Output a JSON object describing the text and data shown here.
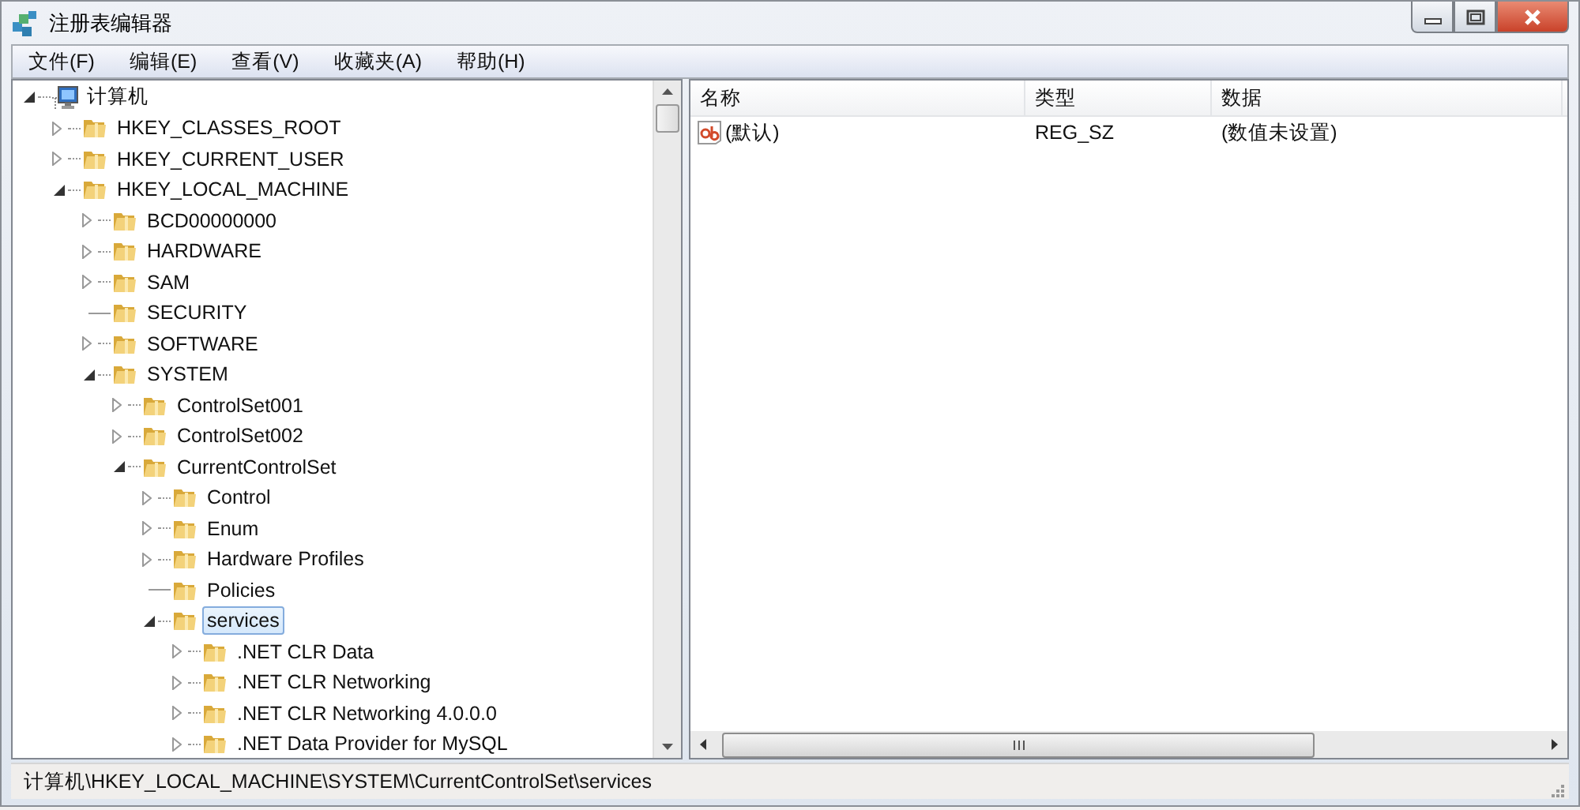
{
  "window": {
    "title": "注册表编辑器"
  },
  "menu": [
    "文件(F)",
    "编辑(E)",
    "查看(V)",
    "收藏夹(A)",
    "帮助(H)"
  ],
  "tree": [
    {
      "label": "计算机",
      "kind": "computer",
      "expanded": true,
      "selected": false,
      "children": [
        {
          "label": "HKEY_CLASSES_ROOT",
          "kind": "key",
          "expanded": false,
          "selected": false
        },
        {
          "label": "HKEY_CURRENT_USER",
          "kind": "key",
          "expanded": false,
          "selected": false
        },
        {
          "label": "HKEY_LOCAL_MACHINE",
          "kind": "key",
          "expanded": true,
          "selected": false,
          "children": [
            {
              "label": "BCD00000000",
              "kind": "key",
              "expanded": false,
              "selected": false
            },
            {
              "label": "HARDWARE",
              "kind": "key",
              "expanded": false,
              "selected": false
            },
            {
              "label": "SAM",
              "kind": "key",
              "expanded": false,
              "selected": false
            },
            {
              "label": "SECURITY",
              "kind": "leaf",
              "selected": false
            },
            {
              "label": "SOFTWARE",
              "kind": "key",
              "expanded": false,
              "selected": false
            },
            {
              "label": "SYSTEM",
              "kind": "key",
              "expanded": true,
              "selected": false,
              "children": [
                {
                  "label": "ControlSet001",
                  "kind": "key",
                  "expanded": false,
                  "selected": false
                },
                {
                  "label": "ControlSet002",
                  "kind": "key",
                  "expanded": false,
                  "selected": false
                },
                {
                  "label": "CurrentControlSet",
                  "kind": "key",
                  "expanded": true,
                  "selected": false,
                  "children": [
                    {
                      "label": "Control",
                      "kind": "key",
                      "expanded": false,
                      "selected": false
                    },
                    {
                      "label": "Enum",
                      "kind": "key",
                      "expanded": false,
                      "selected": false
                    },
                    {
                      "label": "Hardware Profiles",
                      "kind": "key",
                      "expanded": false,
                      "selected": false
                    },
                    {
                      "label": "Policies",
                      "kind": "leaf",
                      "selected": false
                    },
                    {
                      "label": "services",
                      "kind": "key",
                      "expanded": true,
                      "selected": true,
                      "children": [
                        {
                          "label": ".NET CLR Data",
                          "kind": "key",
                          "expanded": false,
                          "selected": false
                        },
                        {
                          "label": ".NET CLR Networking",
                          "kind": "key",
                          "expanded": false,
                          "selected": false
                        },
                        {
                          "label": ".NET CLR Networking 4.0.0.0",
                          "kind": "key",
                          "expanded": false,
                          "selected": false
                        },
                        {
                          "label": ".NET Data Provider for MySQL",
                          "kind": "key",
                          "expanded": false,
                          "selected": false
                        }
                      ]
                    }
                  ]
                }
              ]
            }
          ]
        }
      ]
    }
  ],
  "values_table": {
    "columns": [
      "名称",
      "类型",
      "数据"
    ],
    "rows": [
      {
        "name": "(默认)",
        "type": "REG_SZ",
        "data": "(数值未设置)"
      }
    ]
  },
  "status_bar": "计算机\\HKEY_LOCAL_MACHINE\\SYSTEM\\CurrentControlSet\\services"
}
